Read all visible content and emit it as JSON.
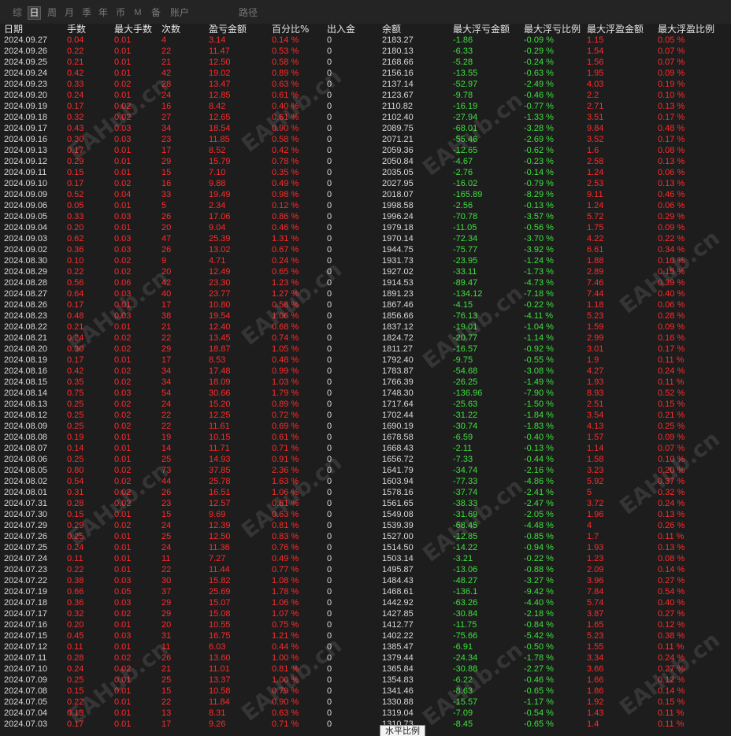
{
  "tabs": [
    {
      "label": "综"
    },
    {
      "label": "日",
      "active": true
    },
    {
      "label": "周"
    },
    {
      "label": "月"
    },
    {
      "label": "季"
    },
    {
      "label": "年"
    },
    {
      "label": "币"
    },
    {
      "label": "M"
    },
    {
      "label": "备"
    },
    {
      "label": "账户"
    },
    {
      "label": "路径"
    }
  ],
  "columns": [
    "日期",
    "手数",
    "最大手数",
    "次数",
    "盈亏金额",
    "百分比%",
    "出入金",
    "余额",
    "最大浮亏金额",
    "最大浮亏比例",
    "最大浮盈金额",
    "最大浮盈比例"
  ],
  "rows": [
    [
      "2024.09.27",
      "0.04",
      "0.01",
      "4",
      "3.14",
      "0.14 %",
      "0",
      "2183.27",
      "-1.86",
      "-0.09 %",
      "1.15",
      "0.05 %"
    ],
    [
      "2024.09.26",
      "0.22",
      "0.01",
      "22",
      "11.47",
      "0.53 %",
      "0",
      "2180.13",
      "-6.33",
      "-0.29 %",
      "1.54",
      "0.07 %"
    ],
    [
      "2024.09.25",
      "0.21",
      "0.01",
      "21",
      "12.50",
      "0.58 %",
      "0",
      "2168.66",
      "-5.28",
      "-0.24 %",
      "1.56",
      "0.07 %"
    ],
    [
      "2024.09.24",
      "0.42",
      "0.01",
      "42",
      "19.02",
      "0.89 %",
      "0",
      "2156.16",
      "-13.55",
      "-0.63 %",
      "1.95",
      "0.09 %"
    ],
    [
      "2024.09.23",
      "0.33",
      "0.02",
      "28",
      "13.47",
      "0.63 %",
      "0",
      "2137.14",
      "-52.97",
      "-2.49 %",
      "4.03",
      "0.19 %"
    ],
    [
      "2024.09.20",
      "0.24",
      "0.01",
      "24",
      "12.85",
      "0.61 %",
      "0",
      "2123.67",
      "-9.78",
      "-0.46 %",
      "2.2",
      "0.10 %"
    ],
    [
      "2024.09.19",
      "0.17",
      "0.02",
      "16",
      "8.42",
      "0.40 %",
      "0",
      "2110.82",
      "-16.19",
      "-0.77 %",
      "2.71",
      "0.13 %"
    ],
    [
      "2024.09.18",
      "0.32",
      "0.02",
      "27",
      "12.65",
      "0.61 %",
      "0",
      "2102.40",
      "-27.94",
      "-1.33 %",
      "3.51",
      "0.17 %"
    ],
    [
      "2024.09.17",
      "0.43",
      "0.03",
      "34",
      "18.54",
      "0.90 %",
      "0",
      "2089.75",
      "-68.01",
      "-3.28 %",
      "9.84",
      "0.48 %"
    ],
    [
      "2024.09.16",
      "0.30",
      "0.03",
      "23",
      "11.85",
      "0.58 %",
      "0",
      "2071.21",
      "-55.46",
      "-2.69 %",
      "3.52",
      "0.17 %"
    ],
    [
      "2024.09.13",
      "0.17",
      "0.01",
      "17",
      "8.52",
      "0.42 %",
      "0",
      "2059.36",
      "-12.65",
      "-0.62 %",
      "1.6",
      "0.08 %"
    ],
    [
      "2024.09.12",
      "0.29",
      "0.01",
      "29",
      "15.79",
      "0.78 %",
      "0",
      "2050.84",
      "-4.67",
      "-0.23 %",
      "2.58",
      "0.13 %"
    ],
    [
      "2024.09.11",
      "0.15",
      "0.01",
      "15",
      "7.10",
      "0.35 %",
      "0",
      "2035.05",
      "-2.76",
      "-0.14 %",
      "1.24",
      "0.06 %"
    ],
    [
      "2024.09.10",
      "0.17",
      "0.02",
      "16",
      "9.88",
      "0.49 %",
      "0",
      "2027.95",
      "-16.02",
      "-0.79 %",
      "2.53",
      "0.13 %"
    ],
    [
      "2024.09.09",
      "0.52",
      "0.04",
      "33",
      "19.49",
      "0.98 %",
      "0",
      "2018.07",
      "-165.89",
      "-8.29 %",
      "9.11",
      "0.46 %"
    ],
    [
      "2024.09.06",
      "0.05",
      "0.01",
      "5",
      "2.34",
      "0.12 %",
      "0",
      "1998.58",
      "-2.56",
      "-0.13 %",
      "1.24",
      "0.06 %"
    ],
    [
      "2024.09.05",
      "0.33",
      "0.03",
      "26",
      "17.06",
      "0.86 %",
      "0",
      "1996.24",
      "-70.78",
      "-3.57 %",
      "5.72",
      "0.29 %"
    ],
    [
      "2024.09.04",
      "0.20",
      "0.01",
      "20",
      "9.04",
      "0.46 %",
      "0",
      "1979.18",
      "-11.05",
      "-0.56 %",
      "1.75",
      "0.09 %"
    ],
    [
      "2024.09.03",
      "0.62",
      "0.03",
      "47",
      "25.39",
      "1.31 %",
      "0",
      "1970.14",
      "-72.34",
      "-3.70 %",
      "4.22",
      "0.22 %"
    ],
    [
      "2024.09.02",
      "0.36",
      "0.03",
      "26",
      "13.02",
      "0.67 %",
      "0",
      "1944.75",
      "-75.77",
      "-3.92 %",
      "6.61",
      "0.34 %"
    ],
    [
      "2024.08.30",
      "0.10",
      "0.02",
      "9",
      "4.71",
      "0.24 %",
      "0",
      "1931.73",
      "-23.95",
      "-1.24 %",
      "1.88",
      "0.10 %"
    ],
    [
      "2024.08.29",
      "0.22",
      "0.02",
      "20",
      "12.49",
      "0.65 %",
      "0",
      "1927.02",
      "-33.11",
      "-1.73 %",
      "2.89",
      "0.15 %"
    ],
    [
      "2024.08.28",
      "0.56",
      "0.06",
      "42",
      "23.30",
      "1.23 %",
      "0",
      "1914.53",
      "-89.47",
      "-4.73 %",
      "7.46",
      "0.39 %"
    ],
    [
      "2024.08.27",
      "0.64",
      "0.03",
      "40",
      "23.77",
      "1.27 %",
      "0",
      "1891.23",
      "-134.12",
      "-7.18 %",
      "7.44",
      "0.40 %"
    ],
    [
      "2024.08.26",
      "0.17",
      "0.01",
      "17",
      "10.80",
      "0.58 %",
      "0",
      "1867.46",
      "-4.15",
      "-0.22 %",
      "1.18",
      "0.06 %"
    ],
    [
      "2024.08.23",
      "0.48",
      "0.03",
      "38",
      "19.54",
      "1.06 %",
      "0",
      "1856.66",
      "-76.13",
      "-4.11 %",
      "5.23",
      "0.28 %"
    ],
    [
      "2024.08.22",
      "0.21",
      "0.01",
      "21",
      "12.40",
      "0.68 %",
      "0",
      "1837.12",
      "-19.01",
      "-1.04 %",
      "1.59",
      "0.09 %"
    ],
    [
      "2024.08.21",
      "0.24",
      "0.02",
      "22",
      "13.45",
      "0.74 %",
      "0",
      "1824.72",
      "-20.77",
      "-1.14 %",
      "2.99",
      "0.16 %"
    ],
    [
      "2024.08.20",
      "0.30",
      "0.02",
      "29",
      "18.87",
      "1.05 %",
      "0",
      "1811.27",
      "-16.57",
      "-0.92 %",
      "3.01",
      "0.17 %"
    ],
    [
      "2024.08.19",
      "0.17",
      "0.01",
      "17",
      "8.53",
      "0.48 %",
      "0",
      "1792.40",
      "-9.75",
      "-0.55 %",
      "1.9",
      "0.11 %"
    ],
    [
      "2024.08.16",
      "0.42",
      "0.02",
      "34",
      "17.48",
      "0.99 %",
      "0",
      "1783.87",
      "-54.68",
      "-3.08 %",
      "4.27",
      "0.24 %"
    ],
    [
      "2024.08.15",
      "0.35",
      "0.02",
      "34",
      "18.09",
      "1.03 %",
      "0",
      "1766.39",
      "-26.25",
      "-1.49 %",
      "1.93",
      "0.11 %"
    ],
    [
      "2024.08.14",
      "0.75",
      "0.03",
      "54",
      "30.66",
      "1.79 %",
      "0",
      "1748.30",
      "-136.96",
      "-7.90 %",
      "8.93",
      "0.52 %"
    ],
    [
      "2024.08.13",
      "0.25",
      "0.02",
      "24",
      "15.20",
      "0.89 %",
      "0",
      "1717.64",
      "-25.63",
      "-1.50 %",
      "2.51",
      "0.15 %"
    ],
    [
      "2024.08.12",
      "0.25",
      "0.02",
      "22",
      "12.25",
      "0.72 %",
      "0",
      "1702.44",
      "-31.22",
      "-1.84 %",
      "3.54",
      "0.21 %"
    ],
    [
      "2024.08.09",
      "0.25",
      "0.02",
      "22",
      "11.61",
      "0.69 %",
      "0",
      "1690.19",
      "-30.74",
      "-1.83 %",
      "4.13",
      "0.25 %"
    ],
    [
      "2024.08.08",
      "0.19",
      "0.01",
      "19",
      "10.15",
      "0.61 %",
      "0",
      "1678.58",
      "-6.59",
      "-0.40 %",
      "1.57",
      "0.09 %"
    ],
    [
      "2024.08.07",
      "0.14",
      "0.01",
      "14",
      "11.71",
      "0.71 %",
      "0",
      "1668.43",
      "-2.11",
      "-0.13 %",
      "1.14",
      "0.07 %"
    ],
    [
      "2024.08.06",
      "0.25",
      "0.01",
      "25",
      "14.93",
      "0.91 %",
      "0",
      "1656.72",
      "-7.33",
      "-0.44 %",
      "1.58",
      "0.10 %"
    ],
    [
      "2024.08.05",
      "0.80",
      "0.02",
      "73",
      "37.85",
      "2.36 %",
      "0",
      "1641.79",
      "-34.74",
      "-2.16 %",
      "3.23",
      "0.20 %"
    ],
    [
      "2024.08.02",
      "0.54",
      "0.02",
      "44",
      "25.78",
      "1.63 %",
      "0",
      "1603.94",
      "-77.33",
      "-4.86 %",
      "5.92",
      "0.37 %"
    ],
    [
      "2024.08.01",
      "0.31",
      "0.02",
      "26",
      "16.51",
      "1.06 %",
      "0",
      "1578.16",
      "-37.74",
      "-2.41 %",
      "5",
      "0.32 %"
    ],
    [
      "2024.07.31",
      "0.28",
      "0.02",
      "23",
      "12.57",
      "0.81 %",
      "0",
      "1561.65",
      "-38.33",
      "-2.47 %",
      "3.72",
      "0.24 %"
    ],
    [
      "2024.07.30",
      "0.15",
      "0.01",
      "15",
      "9.69",
      "0.63 %",
      "0",
      "1549.08",
      "-31.69",
      "-2.05 %",
      "1.96",
      "0.13 %"
    ],
    [
      "2024.07.29",
      "0.29",
      "0.02",
      "24",
      "12.39",
      "0.81 %",
      "0",
      "1539.39",
      "-68.45",
      "-4.48 %",
      "4",
      "0.26 %"
    ],
    [
      "2024.07.26",
      "0.25",
      "0.01",
      "25",
      "12.50",
      "0.83 %",
      "0",
      "1527.00",
      "-12.85",
      "-0.85 %",
      "1.7",
      "0.11 %"
    ],
    [
      "2024.07.25",
      "0.24",
      "0.01",
      "24",
      "11.36",
      "0.76 %",
      "0",
      "1514.50",
      "-14.22",
      "-0.94 %",
      "1.93",
      "0.13 %"
    ],
    [
      "2024.07.24",
      "0.11",
      "0.01",
      "11",
      "7.27",
      "0.49 %",
      "0",
      "1503.14",
      "-3.21",
      "-0.22 %",
      "1.23",
      "0.08 %"
    ],
    [
      "2024.07.23",
      "0.22",
      "0.01",
      "22",
      "11.44",
      "0.77 %",
      "0",
      "1495.87",
      "-13.06",
      "-0.88 %",
      "2.09",
      "0.14 %"
    ],
    [
      "2024.07.22",
      "0.38",
      "0.03",
      "30",
      "15.82",
      "1.08 %",
      "0",
      "1484.43",
      "-48.27",
      "-3.27 %",
      "3.96",
      "0.27 %"
    ],
    [
      "2024.07.19",
      "0.66",
      "0.05",
      "37",
      "25.69",
      "1.78 %",
      "0",
      "1468.61",
      "-136.1",
      "-9.42 %",
      "7.84",
      "0.54 %"
    ],
    [
      "2024.07.18",
      "0.36",
      "0.03",
      "29",
      "15.07",
      "1.06 %",
      "0",
      "1442.92",
      "-63.26",
      "-4.40 %",
      "5.74",
      "0.40 %"
    ],
    [
      "2024.07.17",
      "0.32",
      "0.02",
      "29",
      "15.08",
      "1.07 %",
      "0",
      "1427.85",
      "-30.84",
      "-2.18 %",
      "3.87",
      "0.27 %"
    ],
    [
      "2024.07.16",
      "0.20",
      "0.01",
      "20",
      "10.55",
      "0.75 %",
      "0",
      "1412.77",
      "-11.75",
      "-0.84 %",
      "1.65",
      "0.12 %"
    ],
    [
      "2024.07.15",
      "0.45",
      "0.03",
      "31",
      "16.75",
      "1.21 %",
      "0",
      "1402.22",
      "-75.66",
      "-5.42 %",
      "5.23",
      "0.38 %"
    ],
    [
      "2024.07.12",
      "0.11",
      "0.01",
      "11",
      "6.03",
      "0.44 %",
      "0",
      "1385.47",
      "-6.91",
      "-0.50 %",
      "1.55",
      "0.11 %"
    ],
    [
      "2024.07.11",
      "0.28",
      "0.02",
      "26",
      "13.60",
      "1.00 %",
      "0",
      "1379.44",
      "-24.34",
      "-1.78 %",
      "3.34",
      "0.24 %"
    ],
    [
      "2024.07.10",
      "0.24",
      "0.02",
      "21",
      "11.01",
      "0.81 %",
      "0",
      "1365.84",
      "-30.88",
      "-2.27 %",
      "3.66",
      "0.27 %"
    ],
    [
      "2024.07.09",
      "0.25",
      "0.01",
      "25",
      "13.37",
      "1.00 %",
      "0",
      "1354.83",
      "-6.22",
      "-0.46 %",
      "1.66",
      "0.12 %"
    ],
    [
      "2024.07.08",
      "0.15",
      "0.01",
      "15",
      "10.58",
      "0.79 %",
      "0",
      "1341.46",
      "-8.63",
      "-0.65 %",
      "1.86",
      "0.14 %"
    ],
    [
      "2024.07.05",
      "0.22",
      "0.01",
      "22",
      "11.84",
      "0.90 %",
      "0",
      "1330.88",
      "-15.57",
      "-1.17 %",
      "1.92",
      "0.15 %"
    ],
    [
      "2024.07.04",
      "0.13",
      "0.01",
      "13",
      "8.31",
      "0.63 %",
      "0",
      "1319.04",
      "-7.09",
      "-0.54 %",
      "1.43",
      "0.11 %"
    ],
    [
      "2024.07.03",
      "0.17",
      "0.01",
      "17",
      "9.26",
      "0.71 %",
      "0",
      "1310.73",
      "-8.45",
      "-0.65 %",
      "1.4",
      "0.11 %"
    ]
  ],
  "tooltip": "水平比例",
  "watermark": "EAHub.cn",
  "colors": {
    "background": "#1d1d1d",
    "profit": "#ff2b2b",
    "loss": "#3ee03e",
    "text": "#d9d9d9",
    "header": "#e6e6e6"
  }
}
